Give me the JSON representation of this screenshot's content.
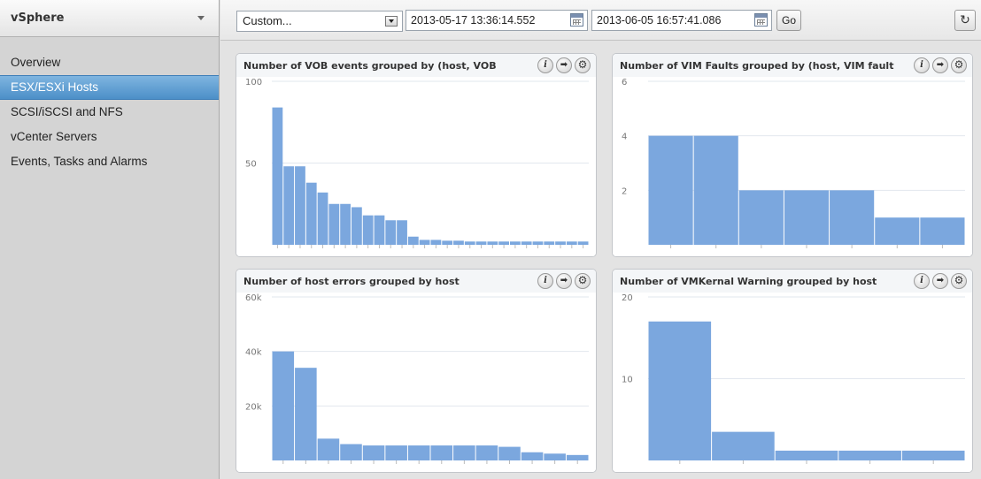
{
  "sidebar": {
    "title": "vSphere",
    "items": [
      {
        "label": "Overview",
        "active": false
      },
      {
        "label": "ESX/ESXi Hosts",
        "active": true
      },
      {
        "label": "SCSI/iSCSI and NFS",
        "active": false
      },
      {
        "label": "vCenter Servers",
        "active": false
      },
      {
        "label": "Events, Tasks and Alarms",
        "active": false
      }
    ]
  },
  "toolbar": {
    "range_select": "Custom...",
    "start_date": "2013-05-17 13:36:14.552",
    "end_date": "2013-06-05 16:57:41.086",
    "go_label": "Go",
    "refresh_icon": "refresh-icon"
  },
  "panels": [
    {
      "title": "Number of VOB events grouped by (host, VOB",
      "icons": [
        "info-icon",
        "arrow-right-icon",
        "gear-icon"
      ]
    },
    {
      "title": "Number of VIM Faults grouped by (host, VIM fault",
      "icons": [
        "info-icon",
        "arrow-right-icon",
        "gear-icon"
      ]
    },
    {
      "title": "Number of host errors grouped by host",
      "icons": [
        "info-icon",
        "arrow-right-icon",
        "gear-icon"
      ]
    },
    {
      "title": "Number of VMKernal Warning grouped by host",
      "icons": [
        "info-icon",
        "arrow-right-icon",
        "gear-icon"
      ]
    }
  ],
  "colors": {
    "bar": "#7ba7de",
    "grid": "#e2e7ee",
    "accent": "#4c8fc8"
  },
  "chart_data": [
    {
      "type": "bar",
      "title": "Number of VOB events grouped by (host, VOB",
      "ylim": [
        0,
        100
      ],
      "yticks": [
        {
          "v": 50,
          "label": "50"
        },
        {
          "v": 100,
          "label": "100"
        }
      ],
      "values": [
        84,
        48,
        48,
        38,
        32,
        25,
        25,
        23,
        18,
        18,
        15,
        15,
        5,
        3,
        3,
        2.5,
        2.5,
        2,
        2,
        2,
        2,
        2,
        2,
        2,
        2,
        2,
        2,
        2
      ]
    },
    {
      "type": "bar",
      "title": "Number of VIM Faults grouped by (host, VIM fault",
      "ylim": [
        0,
        6
      ],
      "yticks": [
        {
          "v": 2,
          "label": "2"
        },
        {
          "v": 4,
          "label": "4"
        },
        {
          "v": 6,
          "label": "6"
        }
      ],
      "values": [
        4,
        4,
        2,
        2,
        2,
        1,
        1
      ]
    },
    {
      "type": "bar",
      "title": "Number of host errors grouped by host",
      "ylim": [
        0,
        60000
      ],
      "yticks": [
        {
          "v": 20000,
          "label": "20k"
        },
        {
          "v": 40000,
          "label": "40k"
        },
        {
          "v": 60000,
          "label": "60k"
        }
      ],
      "values": [
        40000,
        34000,
        8000,
        6000,
        5500,
        5500,
        5500,
        5500,
        5500,
        5500,
        5000,
        3000,
        2500,
        2000
      ]
    },
    {
      "type": "bar",
      "title": "Number of VMKernal Warning grouped by host",
      "ylim": [
        0,
        20
      ],
      "yticks": [
        {
          "v": 10,
          "label": "10"
        },
        {
          "v": 20,
          "label": "20"
        }
      ],
      "values": [
        17,
        3.5,
        1.2,
        1.2,
        1.2
      ]
    }
  ]
}
